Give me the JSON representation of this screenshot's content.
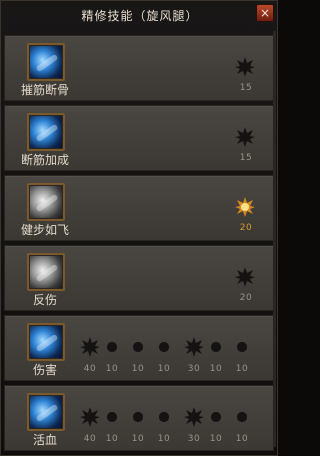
{
  "window": {
    "title": "精修技能（旋风腿）",
    "close_label": "×"
  },
  "rows": [
    {
      "label": "摧筋断骨",
      "icon": "blue-skill-icon",
      "nodes": [
        {
          "value": "15",
          "active": false
        }
      ]
    },
    {
      "label": "断筋加成",
      "icon": "blue-skill-icon",
      "nodes": [
        {
          "value": "15",
          "active": false
        }
      ]
    },
    {
      "label": "健步如飞",
      "icon": "gray-skill-icon",
      "nodes": [
        {
          "value": "20",
          "active": true
        }
      ]
    },
    {
      "label": "反伤",
      "icon": "gray-skill-icon",
      "nodes": [
        {
          "value": "20",
          "active": false
        }
      ]
    },
    {
      "label": "伤害",
      "icon": "blue-skill-icon",
      "nodes": [
        {
          "value": "40"
        },
        {
          "value": "10"
        },
        {
          "value": "10"
        },
        {
          "value": "10"
        },
        {
          "value": "30"
        },
        {
          "value": "10"
        },
        {
          "value": "10"
        }
      ]
    },
    {
      "label": "活血",
      "icon": "blue-skill-icon",
      "nodes": [
        {
          "value": "40"
        },
        {
          "value": "10"
        },
        {
          "value": "10"
        },
        {
          "value": "10"
        },
        {
          "value": "30"
        },
        {
          "value": "10"
        },
        {
          "value": "10"
        }
      ]
    }
  ],
  "colors": {
    "active": "#d79a2b",
    "inactive": "#1a1714",
    "accent": "#e3a325"
  }
}
